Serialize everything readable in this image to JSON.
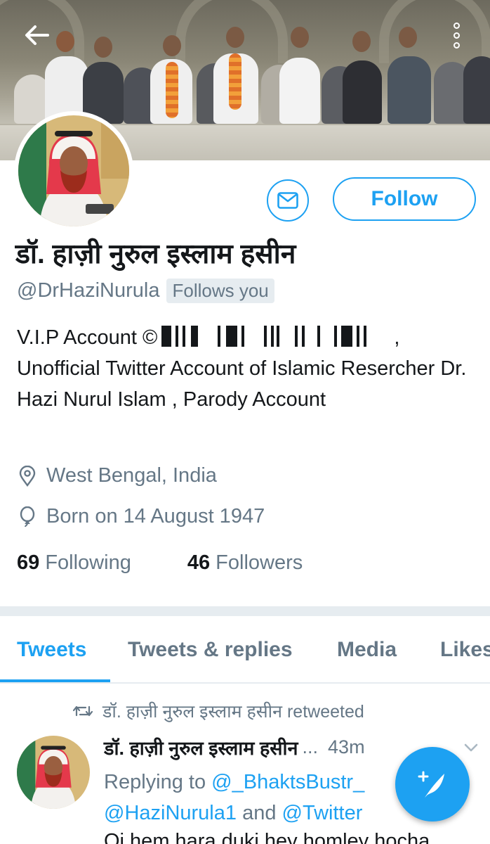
{
  "header": {
    "back_icon": "arrow-left-icon",
    "more_icon": "more-vertical-icon"
  },
  "profile": {
    "display_name": "डॉ. हाज़ी नुरुल इस्लाम हसीन",
    "handle": "@DrHaziNurula",
    "follows_you": "Follows you",
    "follow_label": "Follow",
    "message_icon": "envelope-icon",
    "bio_line1_prefix": "V.I.P Account ©",
    "bio_line1_suffix": ",",
    "bio_rest": "Unofficial Twitter Account of Islamic Resercher Dr. Hazi Nurul Islam , Parody Account",
    "location": "West Bengal, India",
    "born": "Born on 14 August 1947",
    "following_count": "69",
    "following_label": "Following",
    "followers_count": "46",
    "followers_label": "Followers"
  },
  "tabs": [
    {
      "label": "Tweets",
      "active": true
    },
    {
      "label": "Tweets & replies",
      "active": false
    },
    {
      "label": "Media",
      "active": false
    },
    {
      "label": "Likes",
      "active": false
    }
  ],
  "tweet": {
    "retweet_label": "डॉ. हाज़ी नुरुल इस्लाम हसीन retweeted",
    "author_name": "डॉ. हाज़ी नुरुल इस्लाम हसीन",
    "ellipsis": "...",
    "time": "43m",
    "replying_to": "Replying to",
    "mention1": "@_BhaktsBustr_",
    "mention2": "@HaziNurula1",
    "and_label": "and",
    "mention3": "@Twitter",
    "text_start": "Oi hem hara duki hey homley hocha"
  },
  "colors": {
    "accent": "#1da1f2",
    "secondary_text": "#657786",
    "primary_text": "#14171a",
    "divider": "#e6ecf0"
  }
}
